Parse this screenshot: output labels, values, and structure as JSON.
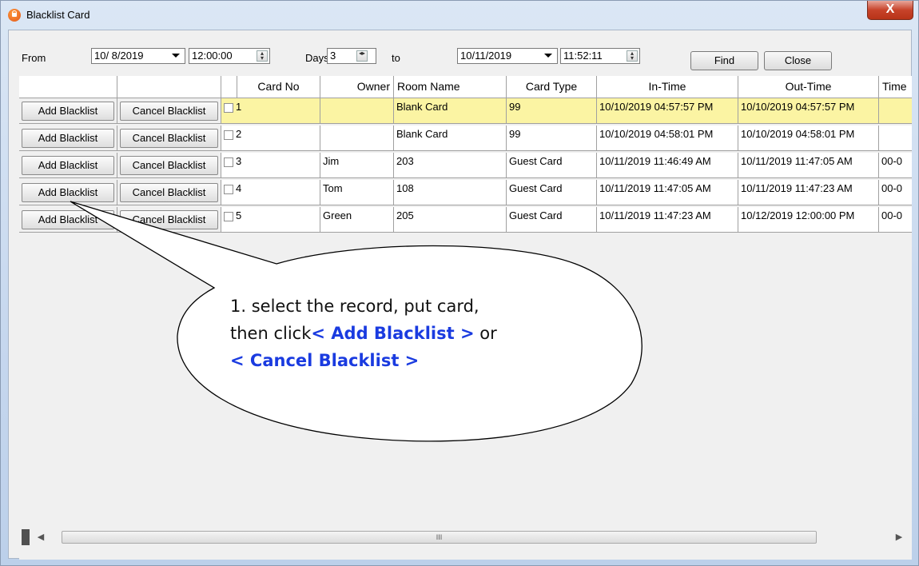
{
  "window": {
    "title": "Blacklist Card",
    "close_glyph": "X"
  },
  "filters": {
    "from_label": "From",
    "from_date": "10/ 8/2019",
    "from_time": "12:00:00",
    "days_label": "Days",
    "days_value": "3",
    "to_label": "to",
    "to_date": "10/11/2019",
    "to_time": "11:52:11",
    "find_label": "Find",
    "close_label": "Close"
  },
  "grid": {
    "headers": [
      "",
      "",
      "",
      "Card No",
      "Owner",
      "Room Name",
      "Card Type",
      "In-Time",
      "Out-Time",
      "Time"
    ],
    "add_label": "Add Blacklist",
    "cancel_label": "Cancel Blacklist",
    "rows": [
      {
        "card_no": "1",
        "owner": "",
        "room": "Blank Card",
        "type": "99",
        "in_time": "10/10/2019 04:57:57 PM",
        "out_time": "10/10/2019 04:57:57 PM",
        "time": ""
      },
      {
        "card_no": "2",
        "owner": "",
        "room": "Blank Card",
        "type": "99",
        "in_time": "10/10/2019 04:58:01 PM",
        "out_time": "10/10/2019 04:58:01 PM",
        "time": ""
      },
      {
        "card_no": "3",
        "owner": "Jim",
        "room": "203",
        "type": "Guest Card",
        "in_time": "10/11/2019 11:46:49 AM",
        "out_time": "10/11/2019 11:47:05 AM",
        "time": "00-0"
      },
      {
        "card_no": "4",
        "owner": "Tom",
        "room": "108",
        "type": "Guest Card",
        "in_time": "10/11/2019 11:47:05 AM",
        "out_time": "10/11/2019 11:47:23 AM",
        "time": "00-0"
      },
      {
        "card_no": "5",
        "owner": "Green",
        "room": "205",
        "type": "Guest Card",
        "in_time": "10/11/2019 11:47:23 AM",
        "out_time": "10/12/2019 12:00:00 PM",
        "time": "00-0"
      }
    ],
    "selected_row": 0
  },
  "scrollbar": {
    "thumb_glyph": "III"
  },
  "callout": {
    "line1": "1. select the record, put card,",
    "line2_prefix": "then click",
    "add_highlight": "< Add Blacklist >",
    "line2_suffix": " or",
    "cancel_highlight": "< Cancel Blacklist >"
  },
  "colors": {
    "selected_row": "#fbf4a3",
    "highlight_text": "#1a3be0",
    "close_button": "#c7432a"
  }
}
